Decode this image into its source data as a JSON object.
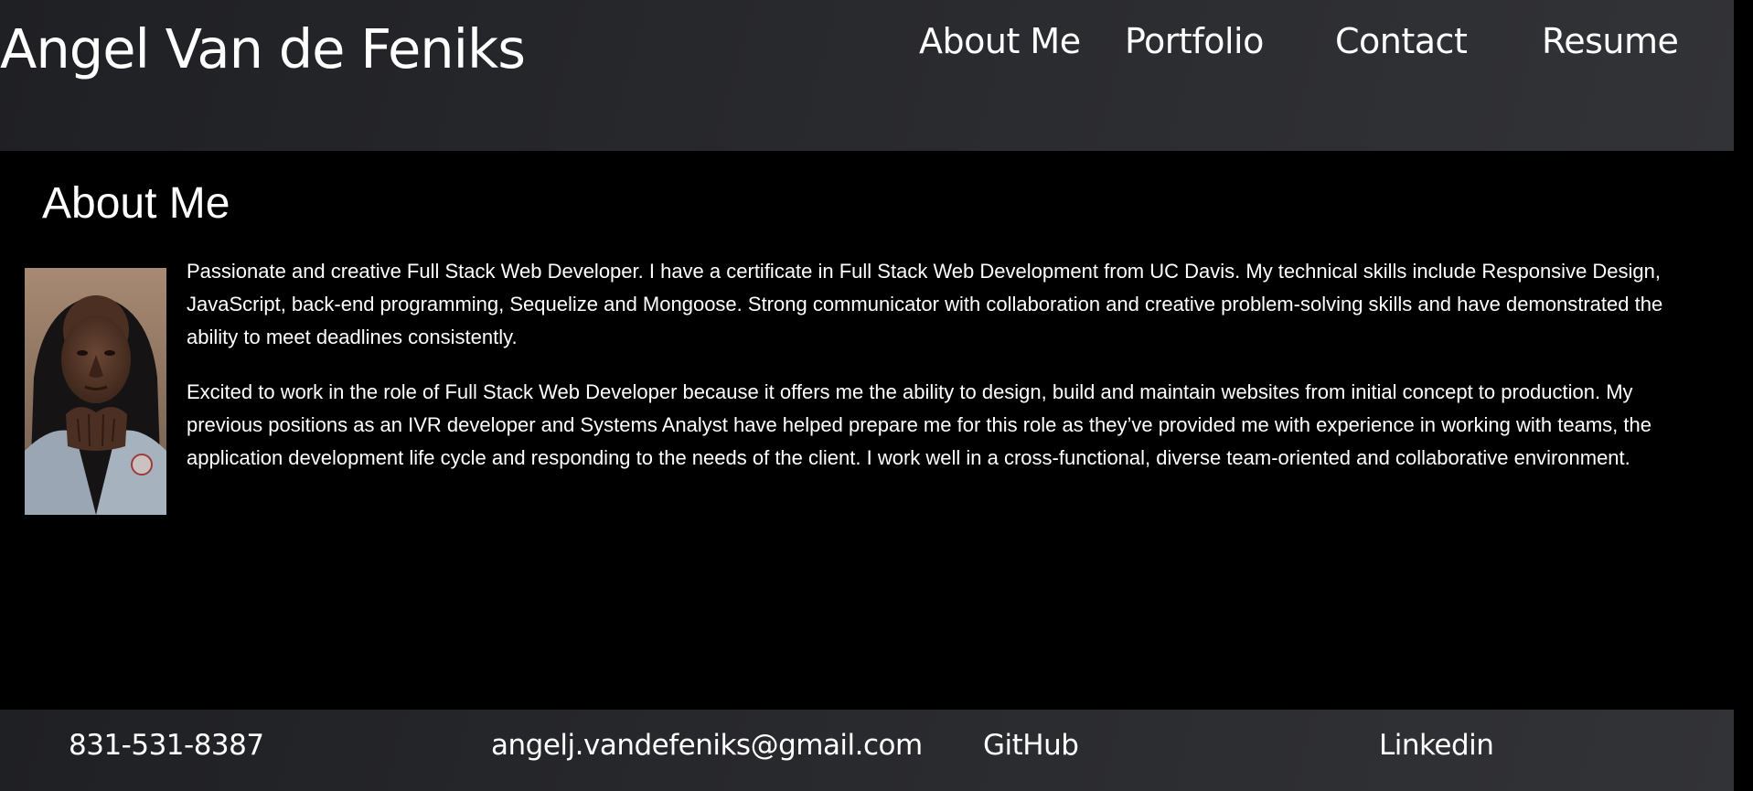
{
  "header": {
    "brand": "Angel Van de Feniks",
    "nav": {
      "about": "About Me",
      "portfolio": "Portfolio",
      "contact": "Contact",
      "resume": "Resume"
    }
  },
  "main": {
    "heading": "About Me",
    "paragraphs": [
      "Passionate and creative Full Stack Web Developer. I have a certificate in Full Stack Web Development from UC Davis. My technical skills include Responsive Design, JavaScript, back-end programming, Sequelize and Mongoose. Strong communicator with collaboration and creative problem-solving skills and have demonstrated the ability to meet deadlines consistently.",
      "Excited to work in the role of Full Stack Web Developer because it offers me the ability to design, build and maintain websites from initial concept to production. My previous positions as an IVR developer and Systems Analyst have helped prepare me for this role as they’ve provided me with experience in working with teams, the application development life cycle and responding to the needs of the client. I work well in a cross-functional, diverse team-oriented and collaborative environment."
    ]
  },
  "footer": {
    "phone": "831-531-8387",
    "email": "angelj.vandefeniks@gmail.com",
    "github": "GitHub",
    "linkedin": "Linkedin"
  },
  "colors": {
    "background": "#000000",
    "bar": "#2a2b2f",
    "text": "#ffffff"
  }
}
